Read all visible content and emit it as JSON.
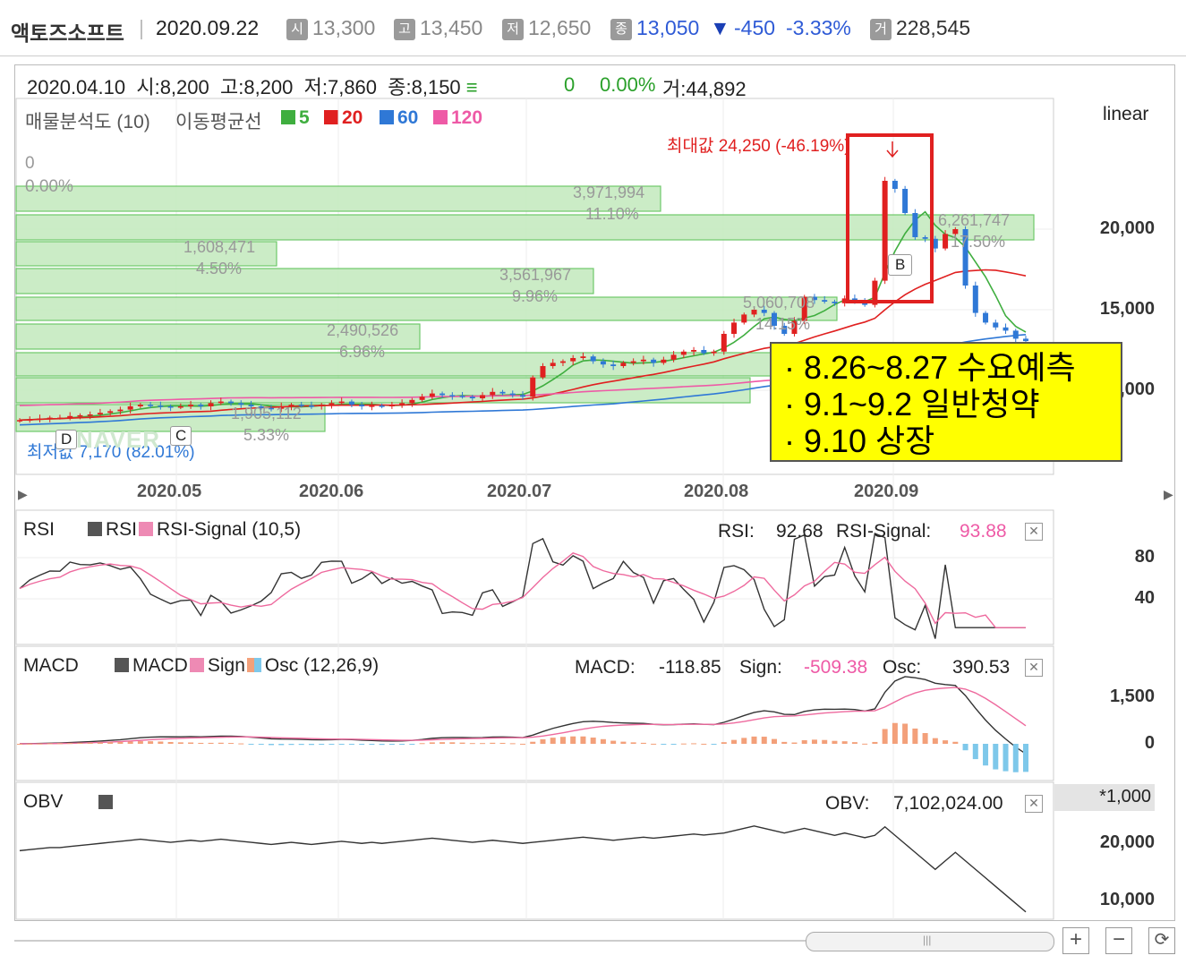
{
  "header": {
    "name": "액토즈소프트",
    "date": "2020.09.22",
    "open_icon": "시",
    "open": "13,300",
    "high_icon": "고",
    "high": "13,450",
    "low_icon": "저",
    "low": "12,650",
    "close_icon": "종",
    "close": "13,050",
    "change_arrow": "▼",
    "change": "-450",
    "change_pct": "-3.33%",
    "volume_icon": "거",
    "volume": "228,545"
  },
  "infoline": {
    "date": "2020.04.10",
    "open": "시:8,200",
    "high": "고:8,200",
    "low": "저:7,860",
    "close": "종:8,150",
    "flat": "≡",
    "chg": "0",
    "chg_pct": "0.00%",
    "vol": "거:44,892"
  },
  "price_panel": {
    "vp_label": "매물분석도 (10)",
    "ma_label": "이동평균선",
    "ma": [
      {
        "label": "5",
        "color": "#3fae3f"
      },
      {
        "label": "20",
        "color": "#e02020"
      },
      {
        "label": "60",
        "color": "#2f78d6"
      },
      {
        "label": "120",
        "color": "#ee5aa6"
      }
    ],
    "scale": "linear",
    "max_label": "최대값 24,250 (-46.19%)",
    "min_label": "최저값 7,170 (82.01%)",
    "top_zero": "0",
    "top_zero_pct": "0.00%",
    "marker_b": "B",
    "marker_d": "D",
    "marker_c": "C",
    "watermark": "NAVER",
    "y_ticks": [
      "20,000",
      "15,000",
      "10,000"
    ]
  },
  "annotation": {
    "lines": [
      "· 8.26~8.27 수요예측",
      "· 9.1~9.2 일반청약",
      "· 9.10 상장"
    ]
  },
  "x_axis": [
    "2020.05",
    "2020.06",
    "2020.07",
    "2020.08",
    "2020.09"
  ],
  "rsi_panel": {
    "title": "RSI",
    "legend": "RSI",
    "legend2": "RSI-Signal (10,5)",
    "rsi_label": "RSI:",
    "rsi_value": "92.68",
    "signal_label": "RSI-Signal:",
    "signal_value": "93.88",
    "y_ticks": [
      "80",
      "40"
    ]
  },
  "macd_panel": {
    "title": "MACD",
    "legend": "MACD",
    "legend2": "Sign",
    "legend3": "Osc (12,26,9)",
    "macd_label": "MACD:",
    "macd_value": "-118.85",
    "sign_label": "Sign:",
    "sign_value": "-509.38",
    "osc_label": "Osc:",
    "osc_value": "390.53",
    "y_ticks": [
      "1,500",
      "0"
    ]
  },
  "obv_panel": {
    "title": "OBV",
    "obv_label": "OBV:",
    "obv_value": "7,102,024.00",
    "multiplier": "*1,000",
    "y_ticks": [
      "20,000",
      "10,000"
    ]
  },
  "colors": {
    "up": "#e02020",
    "down": "#2f78d6",
    "highlight": "#e02020",
    "annotation_bg": "#ffff00"
  },
  "chart_data": {
    "type": "candlestick",
    "title": "액토즈소프트",
    "y_axis": {
      "scale": "linear",
      "ticks": [
        10000,
        15000,
        20000
      ]
    },
    "x_ticks": [
      "2020.05",
      "2020.06",
      "2020.07",
      "2020.08",
      "2020.09"
    ],
    "max": {
      "value": 24250,
      "pct": "-46.19%"
    },
    "min": {
      "value": 7170,
      "pct": "82.01%"
    },
    "price_axis": [
      {
        "y": 20000
      },
      {
        "y": 15000
      },
      {
        "y": 10000
      }
    ],
    "close_series": [
      8150,
      8200,
      8250,
      8300,
      8300,
      8400,
      8450,
      8500,
      8600,
      8700,
      8800,
      9000,
      9100,
      9050,
      9000,
      8950,
      9000,
      9100,
      9000,
      9200,
      9300,
      9200,
      9100,
      9000,
      8900,
      8850,
      9000,
      9100,
      9050,
      9000,
      9100,
      9200,
      9300,
      9100,
      9000,
      9050,
      9000,
      9100,
      9200,
      9400,
      9600,
      9800,
      9700,
      9650,
      9600,
      9500,
      9700,
      9900,
      9800,
      9700,
      9600,
      10800,
      11500,
      11700,
      11800,
      12000,
      12100,
      11800,
      11600,
      11500,
      11700,
      11800,
      11900,
      11700,
      11900,
      12200,
      12400,
      12500,
      12300,
      12400,
      13500,
      14200,
      14700,
      15000,
      14800,
      14000,
      13500,
      14300,
      15800,
      15600,
      15500,
      15400,
      15700,
      15600,
      15300,
      16800,
      23000,
      22500,
      21000,
      19500,
      19400,
      18800,
      19700,
      20000,
      16500,
      14800,
      14200,
      13900,
      13700,
      13200,
      13050
    ],
    "volume_profile": [
      {
        "volume": 3971994,
        "pct": "11.10%"
      },
      {
        "volume": 6261747,
        "pct": "17.50%"
      },
      {
        "volume": 1608471,
        "pct": "4.50%"
      },
      {
        "volume": 3561967,
        "pct": "9.96%"
      },
      {
        "volume": 5060708,
        "pct": "14.15%"
      },
      {
        "volume": 2490526,
        "pct": "6.96%"
      },
      {
        "volume": 1905112,
        "pct": "5.33%"
      }
    ],
    "indicators": {
      "rsi": {
        "period": "10,5",
        "rsi": 92.68,
        "signal": 93.88,
        "ticks": [
          40,
          80
        ]
      },
      "macd": {
        "params": "12,26,9",
        "macd": -118.85,
        "signal": -509.38,
        "osc": 390.53,
        "ticks": [
          0,
          1500
        ]
      },
      "obv": {
        "obv": 7102024.0,
        "multiplier": 1000,
        "ticks": [
          10000,
          20000
        ]
      }
    }
  }
}
